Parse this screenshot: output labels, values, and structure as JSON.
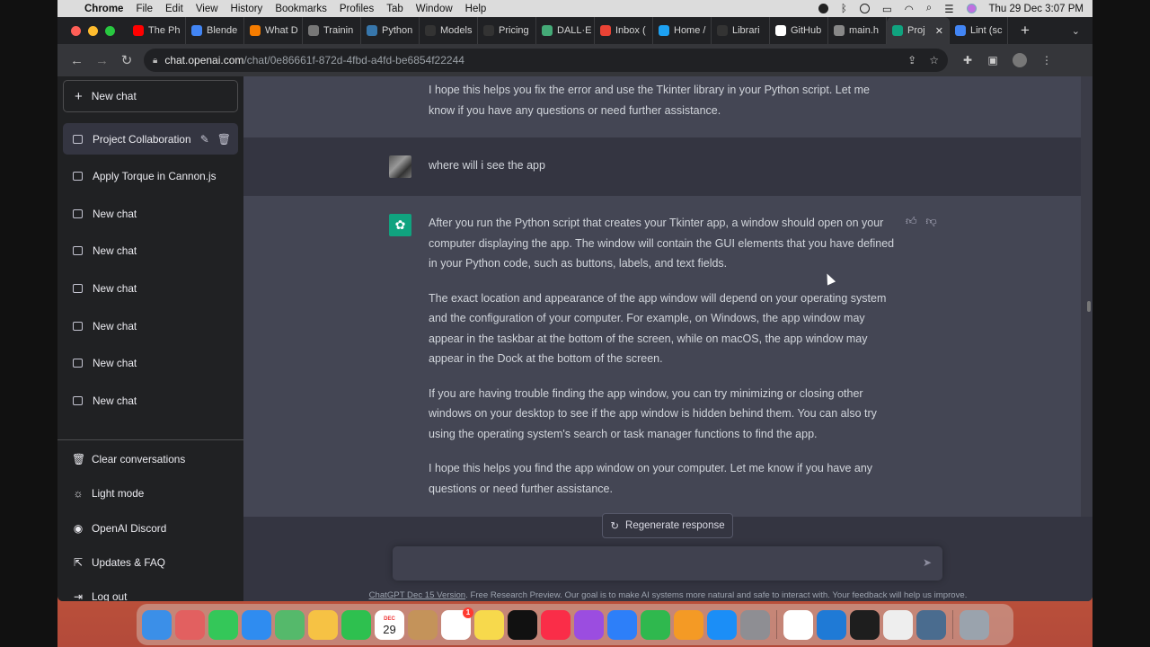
{
  "menubar": {
    "app": "Chrome",
    "items": [
      "File",
      "Edit",
      "View",
      "History",
      "Bookmarks",
      "Profiles",
      "Tab",
      "Window",
      "Help"
    ],
    "clock": "Thu 29 Dec  3:07 PM"
  },
  "tabs": [
    {
      "label": "The Ph",
      "icon": "youtube-icon",
      "color": "#ff0000"
    },
    {
      "label": "Blende",
      "icon": "docs-icon",
      "color": "#4285f4"
    },
    {
      "label": "What D",
      "icon": "blogger-icon",
      "color": "#f57c00"
    },
    {
      "label": "Trainin",
      "icon": "robot-icon",
      "color": "#777777"
    },
    {
      "label": "Python",
      "icon": "python-icon",
      "color": "#3776ab"
    },
    {
      "label": "Models",
      "icon": "openai-icon",
      "color": "#333333"
    },
    {
      "label": "Pricing",
      "icon": "openai-icon",
      "color": "#333333"
    },
    {
      "label": "DALL·E",
      "icon": "dalle-icon",
      "color": "#44aa77"
    },
    {
      "label": "Inbox (",
      "icon": "gmail-icon",
      "color": "#ea4335"
    },
    {
      "label": "Home /",
      "icon": "twitter-icon",
      "color": "#1da1f2"
    },
    {
      "label": "Librari",
      "icon": "openai-icon",
      "color": "#333333"
    },
    {
      "label": "GitHub",
      "icon": "github-icon",
      "color": "#ffffff"
    },
    {
      "label": "main.h",
      "icon": "globe-icon",
      "color": "#888888"
    },
    {
      "label": "Proj",
      "icon": "chatgpt-icon",
      "color": "#10a37f"
    },
    {
      "label": "Lint (sc",
      "icon": "google-icon",
      "color": "#4285f4"
    }
  ],
  "url": {
    "host": "chat.openai.com",
    "path": "/chat/0e86661f-872d-4fbd-a4fd-be6854f22244"
  },
  "sidebar": {
    "new_chat": "New chat",
    "conversations": [
      "Project Collaboration",
      "Apply Torque in Cannon.js",
      "New chat",
      "New chat",
      "New chat",
      "New chat",
      "New chat",
      "New chat"
    ],
    "bottom": [
      {
        "label": "Clear conversations",
        "icon": "trash-icon"
      },
      {
        "label": "Light mode",
        "icon": "sun-icon"
      },
      {
        "label": "OpenAI Discord",
        "icon": "discord-icon"
      },
      {
        "label": "Updates & FAQ",
        "icon": "external-link-icon"
      },
      {
        "label": "Log out",
        "icon": "logout-icon"
      }
    ]
  },
  "chat": {
    "prev_ai_tail": "I hope this helps you fix the error and use the Tkinter library in your Python script. Let me know if you have any questions or need further assistance.",
    "user_message": "where will i see the app",
    "ai_paragraphs": [
      "After you run the Python script that creates your Tkinter app, a window should open on your computer displaying the app. The window will contain the GUI elements that you have defined in your Python code, such as buttons, labels, and text fields.",
      "The exact location and appearance of the app window will depend on your operating system and the configuration of your computer. For example, on Windows, the app window may appear in the taskbar at the bottom of the screen, while on macOS, the app window may appear in the Dock at the bottom of the screen.",
      "If you are having trouble finding the app window, you can try minimizing or closing other windows on your desktop to see if the app window is hidden behind them. You can also try using the operating system's search or task manager functions to find the app.",
      "I hope this helps you find the app window on your computer. Let me know if you have any questions or need further assistance."
    ],
    "regenerate": "Regenerate response",
    "input_placeholder": "",
    "footer_link": "ChatGPT Dec 15 Version",
    "footer_text": ". Free Research Preview. Our goal is to make AI systems more natural and safe to interact with. Your feedback will help us improve."
  },
  "dock": {
    "calendar_month": "DEC",
    "calendar_day": "29",
    "reminders_badge": "1",
    "apps": [
      {
        "name": "finder-icon",
        "color": "#3b8fe8"
      },
      {
        "name": "launchpad-icon",
        "color": "#e26060"
      },
      {
        "name": "messages-icon",
        "color": "#34c759"
      },
      {
        "name": "mail-icon",
        "color": "#2f8cf0"
      },
      {
        "name": "maps-icon",
        "color": "#55b96b"
      },
      {
        "name": "photos-icon",
        "color": "#f6c244"
      },
      {
        "name": "facetime-icon",
        "color": "#2ec04f"
      },
      {
        "name": "calendar-icon",
        "color": "#ffffff"
      },
      {
        "name": "contacts-icon",
        "color": "#c4935a"
      },
      {
        "name": "reminders-icon",
        "color": "#ffffff"
      },
      {
        "name": "notes-icon",
        "color": "#f7d94c"
      },
      {
        "name": "appletv-icon",
        "color": "#111111"
      },
      {
        "name": "music-icon",
        "color": "#fa2d48"
      },
      {
        "name": "podcasts-icon",
        "color": "#9b4de0"
      },
      {
        "name": "keynote-icon",
        "color": "#2d7ff9"
      },
      {
        "name": "numbers-icon",
        "color": "#2fb84e"
      },
      {
        "name": "pages-icon",
        "color": "#f49a25"
      },
      {
        "name": "appstore-icon",
        "color": "#1b8ef7"
      },
      {
        "name": "settings-icon",
        "color": "#8e8e93"
      },
      {
        "name": "chrome-icon",
        "color": "#ffffff"
      },
      {
        "name": "vscode-icon",
        "color": "#1f7ad6"
      },
      {
        "name": "terminal-icon",
        "color": "#1e1e1e"
      },
      {
        "name": "textedit-icon",
        "color": "#eeeeee"
      },
      {
        "name": "quicktime-icon",
        "color": "#4a6c8f"
      },
      {
        "name": "trash-icon",
        "color": "#9aa3ad"
      }
    ]
  },
  "colors": {
    "sidebar": "#202123",
    "main": "#343541",
    "ai_band": "#444654",
    "accent": "#10a37f"
  }
}
